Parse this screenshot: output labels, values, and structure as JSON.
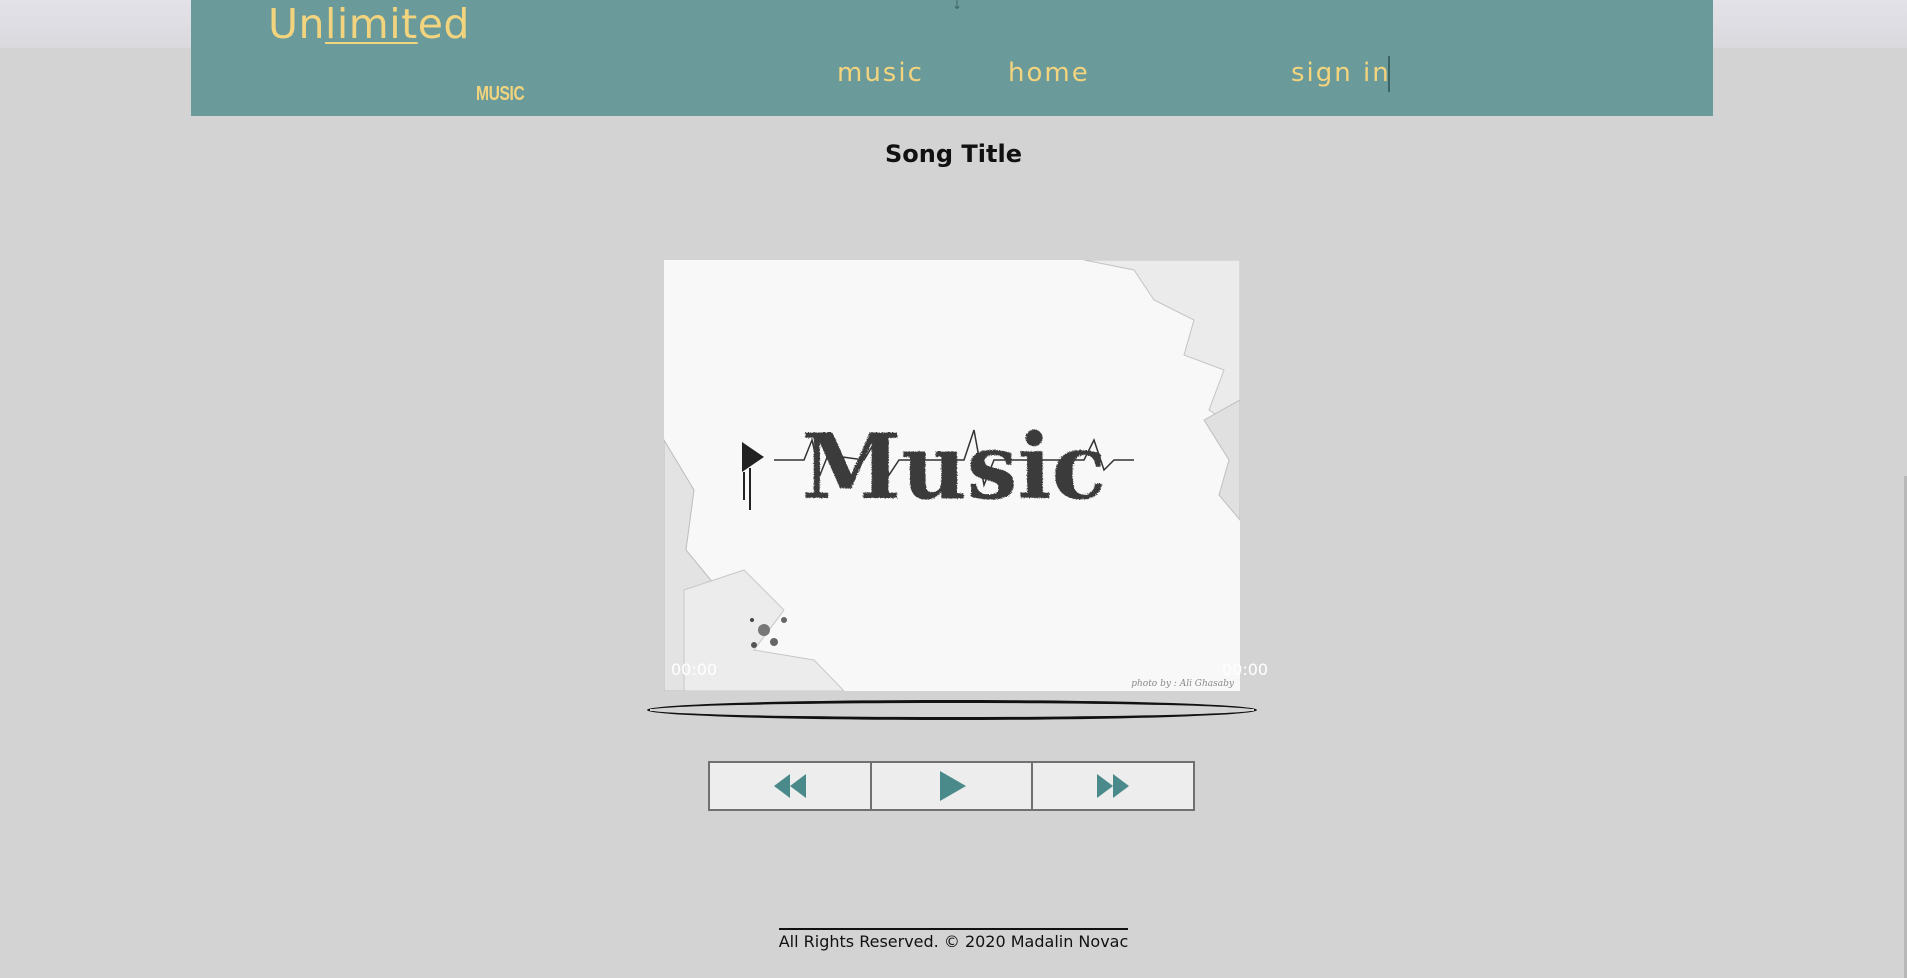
{
  "header": {
    "logo": {
      "part1": "Un",
      "part2": "limit",
      "part3": "ed"
    },
    "logo_sub": "MUSIC",
    "nav": {
      "music": "music",
      "home": "home",
      "sign_in": "sign in"
    }
  },
  "player": {
    "song_title": "Song Title",
    "cover_word": "Music",
    "cover_credit": "photo by : Ali Ghasaby",
    "time_current": "00:00",
    "time_duration": "00:00",
    "progress": 0,
    "controls": {
      "prev_icon": "rewind-icon",
      "play_icon": "play-icon",
      "next_icon": "fast-forward-icon"
    }
  },
  "footer": {
    "text": "All Rights Reserved. © 2020 Madalin Novac"
  },
  "colors": {
    "header_bg": "#6a9a9a",
    "accent_gold": "#f3d47e",
    "icon_teal": "#4a8a8a",
    "page_bg": "#d3d3d3"
  }
}
